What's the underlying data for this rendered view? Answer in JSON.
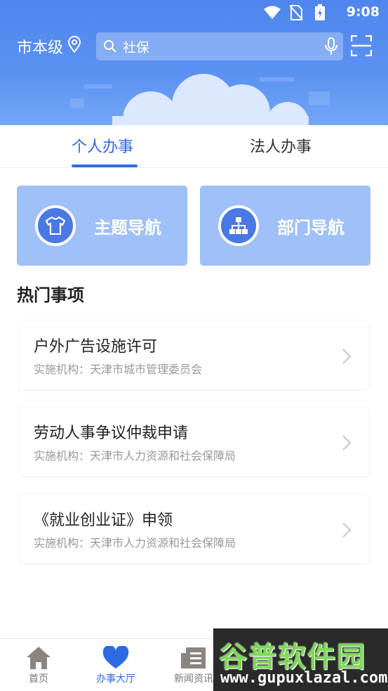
{
  "status": {
    "time": "9:08"
  },
  "header": {
    "city": "市本级",
    "search_placeholder": "社保"
  },
  "tabs": [
    {
      "label": "个人办事",
      "active": true
    },
    {
      "label": "法人办事",
      "active": false
    }
  ],
  "nav_cards": [
    {
      "label": "主题导航",
      "icon": "tshirt-icon"
    },
    {
      "label": "部门导航",
      "icon": "org-chart-icon"
    }
  ],
  "section_title": "热门事项",
  "items": [
    {
      "title": "户外广告设施许可",
      "agency": "实施机构：天津市城市管理委员会"
    },
    {
      "title": "劳动人事争议仲裁申请",
      "agency": "实施机构：天津市人力资源和社会保障局"
    },
    {
      "title": "《就业创业证》申领",
      "agency": "实施机构：天津市人力资源和社会保障局"
    }
  ],
  "bottom_nav": [
    {
      "label": "首页",
      "icon": "home-icon",
      "active": false
    },
    {
      "label": "办事大厅",
      "icon": "heart-icon",
      "active": true
    },
    {
      "label": "新闻资讯",
      "icon": "news-icon",
      "active": false
    }
  ],
  "watermark": {
    "text": "谷普软件园",
    "url": "www.gupuxlazal.com"
  },
  "colors": {
    "accent": "#2d6be4",
    "header": "#4f86ee",
    "card": "#9fc0f8"
  }
}
